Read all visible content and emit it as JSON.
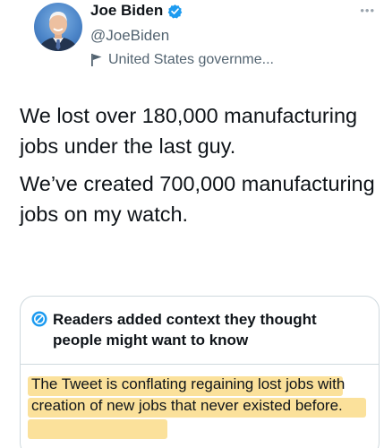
{
  "author": {
    "display_name": "Joe Biden",
    "handle": "@JoeBiden",
    "label": "United States governme..."
  },
  "tweet": {
    "paragraph_1": "We lost over 180,000 manufacturing jobs under the last guy.",
    "paragraph_2": "We’ve created 700,000 manufacturing jobs on my watch."
  },
  "context": {
    "title": "Readers added context they thought people might want to know",
    "body": "The Tweet is conflating regaining lost jobs with creation of new jobs that never existed before."
  },
  "colors": {
    "verified": "#1d9bf0",
    "secondary_text": "#536471",
    "highlight": "#f7c948"
  },
  "icons": {
    "verified": "verified-badge-icon",
    "label": "flag-icon",
    "more": "more-icon",
    "context": "birdwatch-icon"
  }
}
